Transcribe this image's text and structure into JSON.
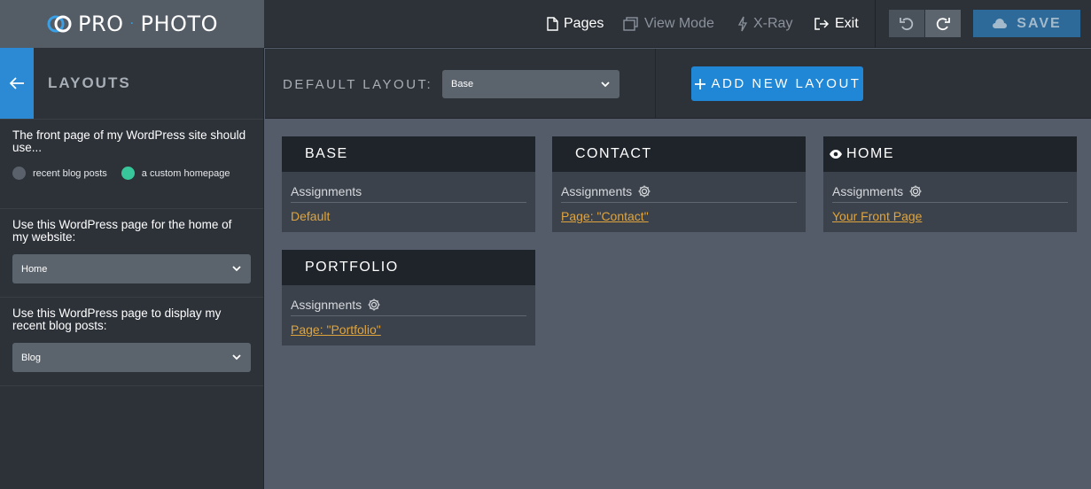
{
  "brand": {
    "name_left": "PRO",
    "name_right": "PHOTO"
  },
  "topnav": {
    "pages": "Pages",
    "view_mode": "View Mode",
    "xray": "X-Ray",
    "exit": "Exit",
    "save": "SAVE"
  },
  "sidebar": {
    "title": "LAYOUTS",
    "front_page_question": "The front page of my WordPress site should use...",
    "radio_options": [
      "recent blog posts",
      "a custom homepage"
    ],
    "radio_selected": "a custom homepage",
    "home_page_label": "Use this WordPress page for the home of my website:",
    "home_page_value": "Home",
    "blog_page_label": "Use this WordPress page to display my recent blog posts:",
    "blog_page_value": "Blog"
  },
  "toolbar": {
    "default_layout_label": "DEFAULT LAYOUT:",
    "default_layout_value": "Base",
    "add_new_layout": "ADD NEW LAYOUT"
  },
  "layouts": [
    {
      "name": "BASE",
      "assignments_label": "Assignments",
      "assignment": "Default",
      "has_settings": false,
      "is_front": false
    },
    {
      "name": "CONTACT",
      "assignments_label": "Assignments",
      "assignment": "Page: \"Contact\"",
      "has_settings": true,
      "is_front": false
    },
    {
      "name": "HOME",
      "assignments_label": "Assignments",
      "assignment": "Your Front Page",
      "has_settings": true,
      "is_front": true
    },
    {
      "name": "PORTFOLIO",
      "assignments_label": "Assignments",
      "assignment": "Page: \"Portfolio\"",
      "has_settings": true,
      "is_front": false
    }
  ],
  "colors": {
    "accent": "#1f87d6",
    "link": "#e0a43d",
    "radio_on": "#38c79a"
  }
}
